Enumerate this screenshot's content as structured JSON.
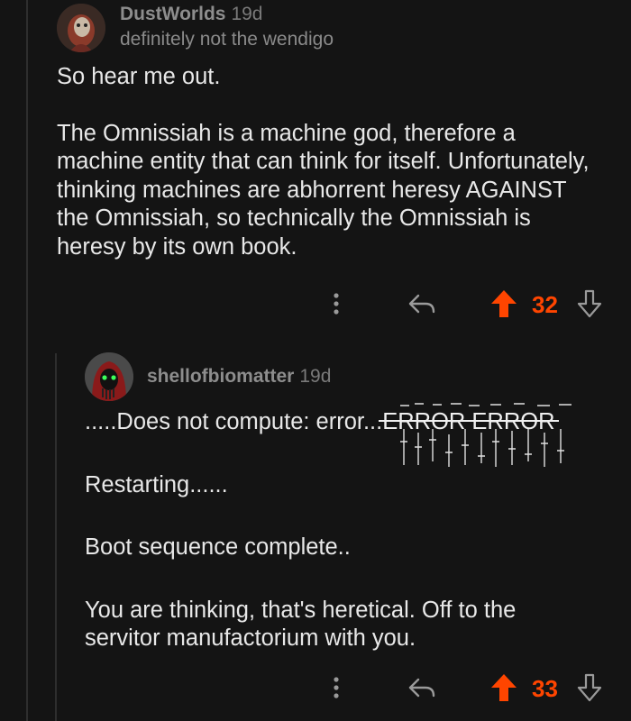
{
  "comment": {
    "username": "DustWorlds",
    "age": "19d",
    "flair": "definitely not the wendigo",
    "paragraphs": [
      "So hear me out.",
      "The Omnissiah is a machine god, therefore a machine entity that can think for itself. Unfortunately, thinking machines are abhorrent heresy AGAINST the Omnissiah, so technically the Omnissiah is heresy by its own book."
    ],
    "score": "32"
  },
  "reply": {
    "username": "shellofbiomatter",
    "age": "19d",
    "line1_prefix": ".....Does not compute: error...",
    "line1_glitch": "ERROR ERROR",
    "paragraphs": [
      "Restarting......",
      "Boot sequence complete..",
      "You are thinking, that's heretical. Off to the servitor manufactorium with you."
    ],
    "score": "33"
  },
  "colors": {
    "background": "#141414",
    "upvote_active": "#ff4500",
    "meta_text": "#8d8d8d"
  },
  "icons": {
    "more": "more-vertical-icon",
    "reply": "reply-arrow-icon",
    "upvote": "upvote-arrow-icon",
    "downvote": "downvote-arrow-icon"
  }
}
